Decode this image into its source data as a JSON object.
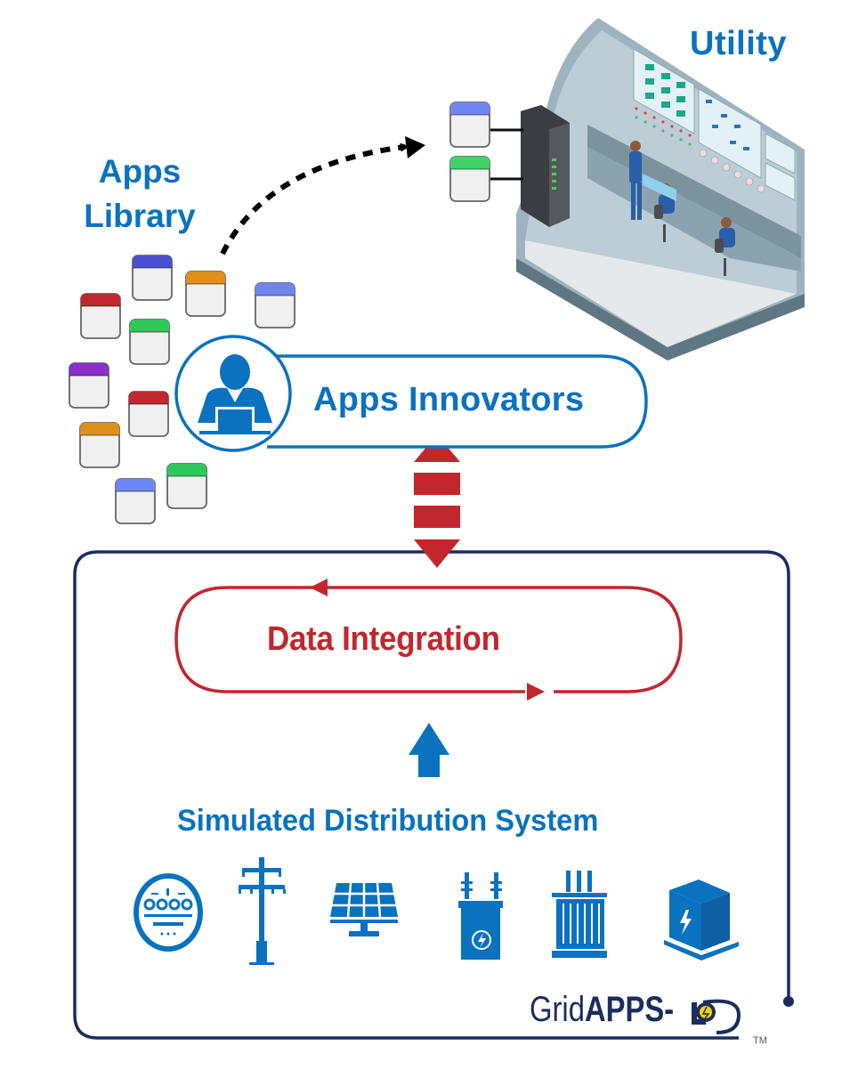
{
  "diagram": {
    "utility": {
      "label": "Utility",
      "illustration": "control-room-illustration",
      "connected_apps": [
        {
          "color": "#6f86f2"
        },
        {
          "color": "#3fd36a"
        }
      ]
    },
    "apps_library": {
      "label_line1": "Apps",
      "label_line2": "Library",
      "apps": [
        {
          "color": "#4a4fcf"
        },
        {
          "color": "#e0901a"
        },
        {
          "color": "#c0282e"
        },
        {
          "color": "#2fc85a"
        },
        {
          "color": "#6f86f2"
        },
        {
          "color": "#8a2fc9"
        },
        {
          "color": "#c0282e"
        },
        {
          "color": "#e0901a"
        },
        {
          "color": "#2fc85a"
        },
        {
          "color": "#6f86f2"
        }
      ]
    },
    "apps_innovators": {
      "label": "Apps Innovators",
      "icon": "person-at-laptop-icon"
    },
    "data_integration": {
      "label": "Data Integration"
    },
    "simulated_distribution_system": {
      "label": "Simulated Distribution System",
      "icons": [
        "electric-meter-icon",
        "utility-pole-icon",
        "solar-panel-icon",
        "pole-transformer-icon",
        "substation-transformer-icon",
        "pad-mount-transformer-icon"
      ]
    },
    "logo": {
      "part1": "Grid",
      "part2": "APPS-",
      "trademark": "TM"
    },
    "colors": {
      "primary_blue": "#0a72bf",
      "accent_red": "#c1272d",
      "navy": "#1b2d5e",
      "logo_yellow": "#f2d600"
    }
  }
}
